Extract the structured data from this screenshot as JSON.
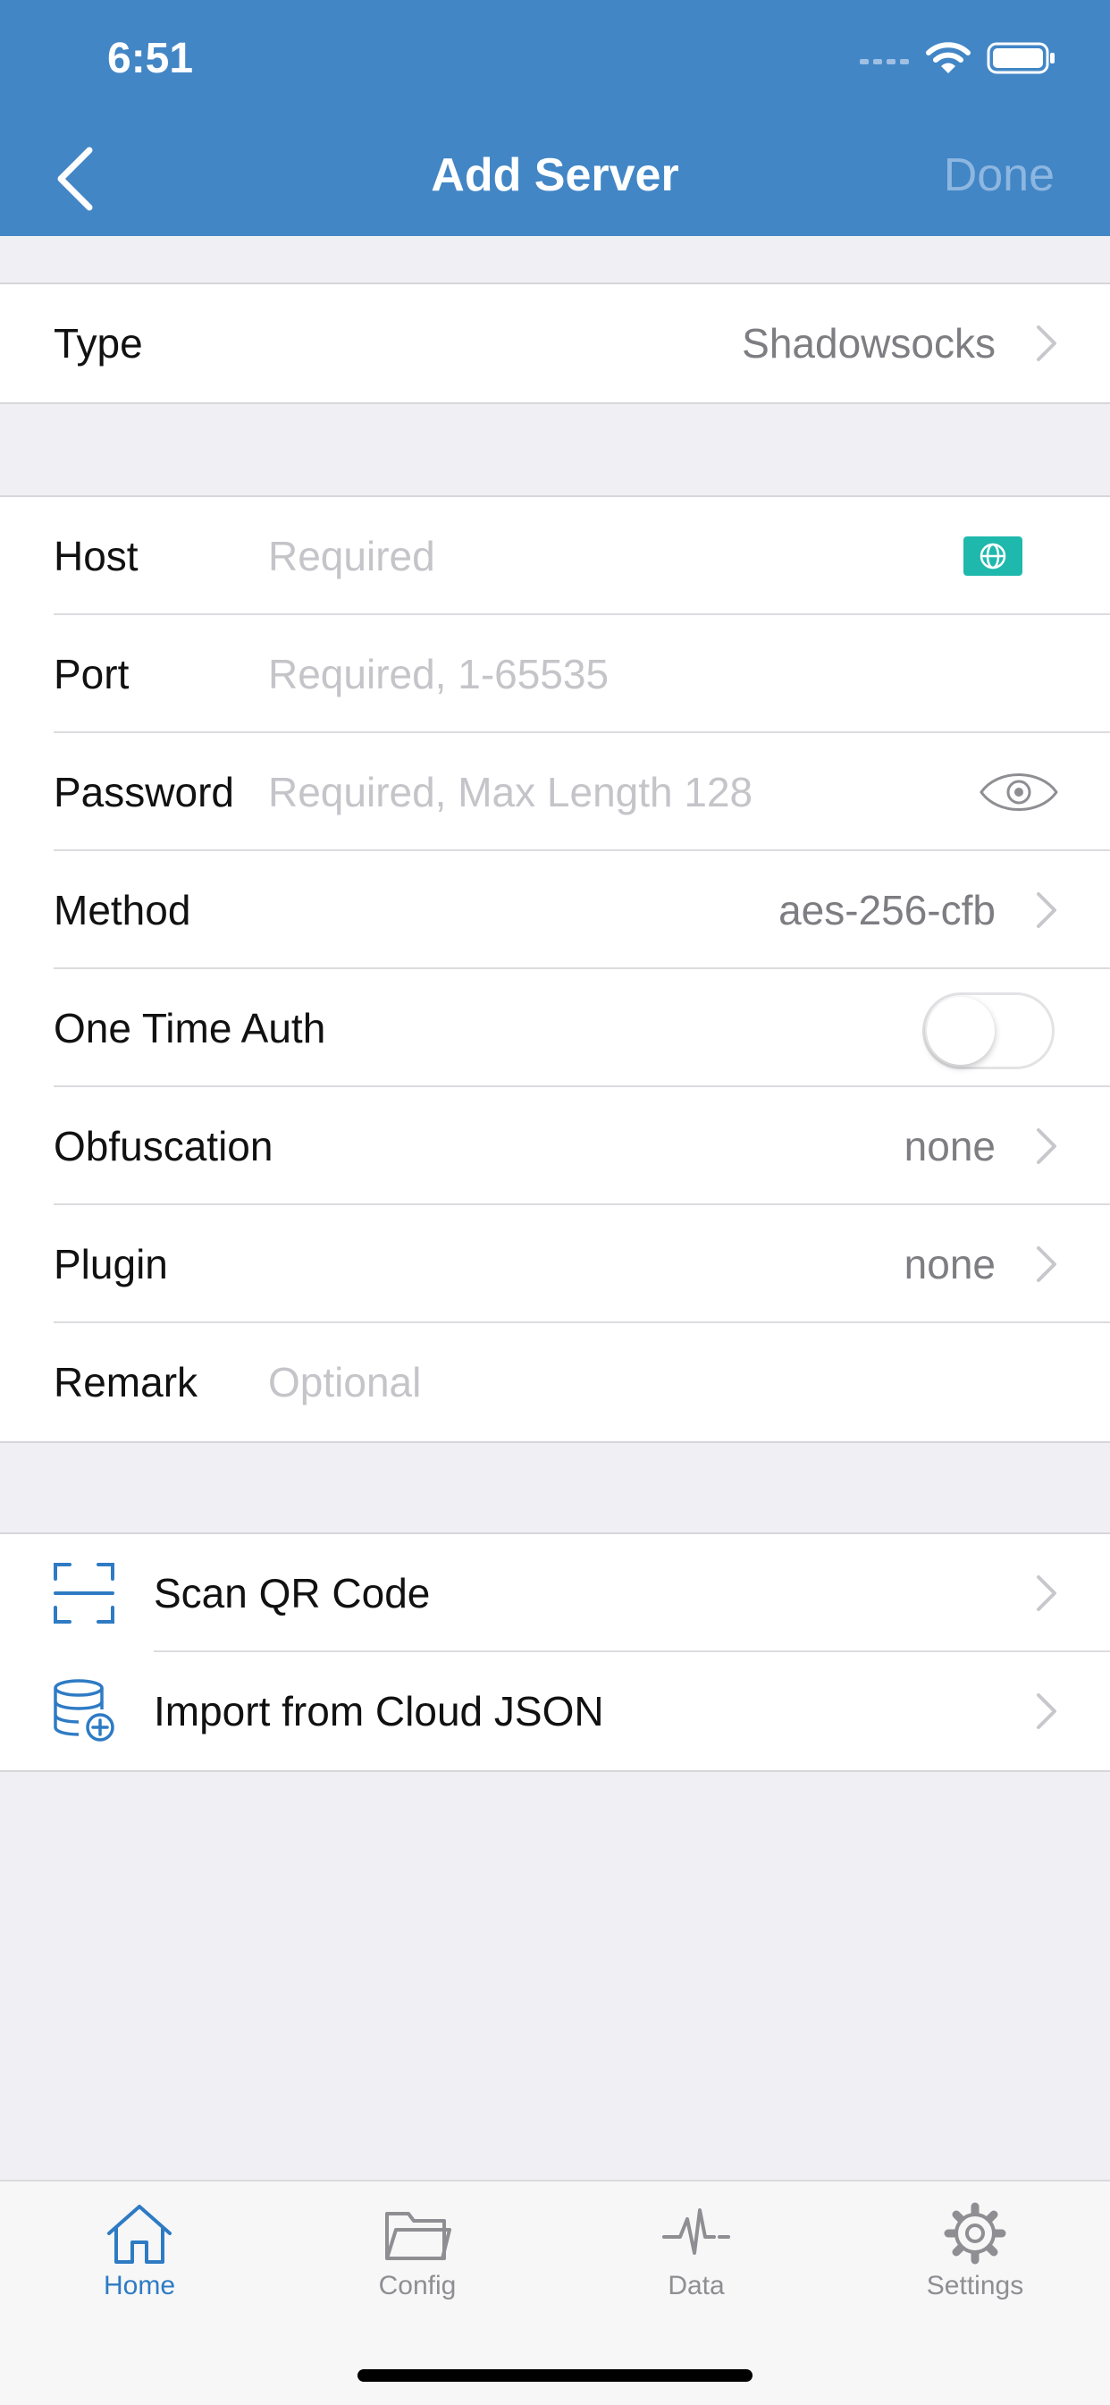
{
  "status_bar": {
    "time": "6:51"
  },
  "nav": {
    "title": "Add Server",
    "done_label": "Done"
  },
  "type_row": {
    "label": "Type",
    "value": "Shadowsocks"
  },
  "form": {
    "host": {
      "label": "Host",
      "placeholder": "Required"
    },
    "port": {
      "label": "Port",
      "placeholder": "Required, 1-65535"
    },
    "password": {
      "label": "Password",
      "placeholder": "Required, Max Length 128"
    },
    "method": {
      "label": "Method",
      "value": "aes-256-cfb"
    },
    "one_time_auth": {
      "label": "One Time Auth",
      "enabled": false
    },
    "obfuscation": {
      "label": "Obfuscation",
      "value": "none"
    },
    "plugin": {
      "label": "Plugin",
      "value": "none"
    },
    "remark": {
      "label": "Remark",
      "placeholder": "Optional"
    }
  },
  "actions": [
    {
      "label": "Scan QR Code",
      "icon": "qr-scan-icon"
    },
    {
      "label": "Import from Cloud JSON",
      "icon": "database-add-icon"
    }
  ],
  "tabs": [
    {
      "label": "Home",
      "icon": "home-icon",
      "active": true
    },
    {
      "label": "Config",
      "icon": "folder-icon",
      "active": false
    },
    {
      "label": "Data",
      "icon": "activity-icon",
      "active": false
    },
    {
      "label": "Settings",
      "icon": "gear-icon",
      "active": false
    }
  ],
  "colors": {
    "accent": "#4286c6",
    "tab_active": "#2e7bc4",
    "globe_button": "#1fb8ad"
  }
}
